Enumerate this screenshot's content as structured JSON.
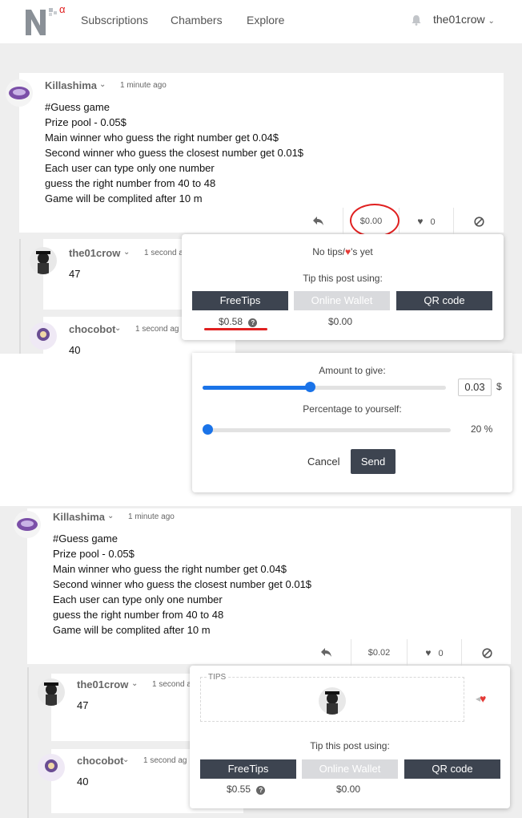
{
  "nav": {
    "subscriptions": "Subscriptions",
    "chambers": "Chambers",
    "explore": "Explore",
    "username": "the01crow",
    "logo_suffix": "α"
  },
  "post": {
    "author": "Killashima",
    "time": "1 minute ago",
    "lines": [
      "#Guess game",
      "Prize pool - 0.05$",
      "Main winner who guess the right number get 0.04$",
      "Second winner who guess the closest number get 0.01$",
      "Each user can type only one number",
      "guess the right number from 40 to 48",
      "Game will be complited after 10 m"
    ],
    "tips_amount": "$0.00",
    "likes": "0"
  },
  "replies": [
    {
      "author": "the01crow",
      "time": "1 second a",
      "text": "47"
    },
    {
      "author": "chocobot",
      "time": "1 second ag",
      "text": "40"
    }
  ],
  "tip_popup": {
    "no_tips": "No tips/",
    "no_tips_suffix": "'s yet",
    "tip_using": "Tip this post using:",
    "freetips": "FreeTips",
    "online_wallet": "Online Wallet",
    "qr_code": "QR code",
    "freetips_balance": "$0.58",
    "wallet_balance": "$0.00",
    "help_glyph": "?"
  },
  "amount_panel": {
    "amount_label": "Amount to give:",
    "amount_value": "0.03",
    "currency": "$",
    "amount_fraction": 0.44,
    "percentage_label": "Percentage to yourself:",
    "percentage_value": "20 %",
    "percentage_fraction": 0.0,
    "cancel": "Cancel",
    "send": "Send"
  },
  "post2": {
    "author": "Killashima",
    "time": "1 minute ago",
    "lines": [
      "#Guess game",
      "Prize pool - 0.05$",
      "Main winner who guess the right number get 0.04$",
      "Second winner who guess the closest number get 0.01$",
      "Each user can type only one number",
      "guess the right number from 40 to 48",
      "Game will be complited after 10 m"
    ],
    "tips_amount": "$0.02",
    "likes": "0"
  },
  "replies2": [
    {
      "author": "the01crow",
      "time": "1 second a",
      "text": "47"
    },
    {
      "author": "chocobot",
      "time": "1 second ag",
      "text": "40"
    }
  ],
  "tip_popup2": {
    "tips_heading": "TIPS",
    "tip_using": "Tip this post using:",
    "freetips": "FreeTips",
    "online_wallet": "Online Wallet",
    "qr_code": "QR code",
    "freetips_balance": "$0.55",
    "wallet_balance": "$0.00",
    "help_glyph": "?"
  },
  "colors": {
    "accent_dark": "#3d4450",
    "slider_blue": "#1a73e8",
    "highlight_red": "#e02020",
    "heart_red": "#e53935"
  }
}
